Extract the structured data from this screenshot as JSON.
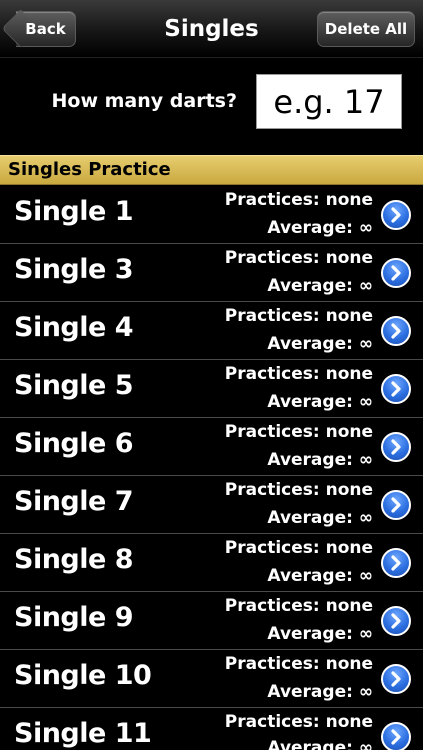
{
  "navbar": {
    "title": "Singles",
    "back_label": "Back",
    "delete_all_label": "Delete All"
  },
  "prompt": {
    "label": "How many darts?",
    "placeholder": "e.g. 17"
  },
  "section": {
    "title": "Singles Practice"
  },
  "rows": [
    {
      "title": "Single 1",
      "practices": "Practices: none",
      "average": "Average: ∞"
    },
    {
      "title": "Single 3",
      "practices": "Practices: none",
      "average": "Average: ∞"
    },
    {
      "title": "Single 4",
      "practices": "Practices: none",
      "average": "Average: ∞"
    },
    {
      "title": "Single 5",
      "practices": "Practices: none",
      "average": "Average: ∞"
    },
    {
      "title": "Single 6",
      "practices": "Practices: none",
      "average": "Average: ∞"
    },
    {
      "title": "Single 7",
      "practices": "Practices: none",
      "average": "Average: ∞"
    },
    {
      "title": "Single 8",
      "practices": "Practices: none",
      "average": "Average: ∞"
    },
    {
      "title": "Single 9",
      "practices": "Practices: none",
      "average": "Average: ∞"
    },
    {
      "title": "Single 10",
      "practices": "Practices: none",
      "average": "Average: ∞"
    },
    {
      "title": "Single 11",
      "practices": "Practices: none",
      "average": "Average: ∞"
    }
  ],
  "icons": {
    "row_disclosure": "chevron-right-circle-icon"
  },
  "colors": {
    "section_gold": "#d8bb55",
    "disclosure_blue": "#2c6fe0"
  }
}
